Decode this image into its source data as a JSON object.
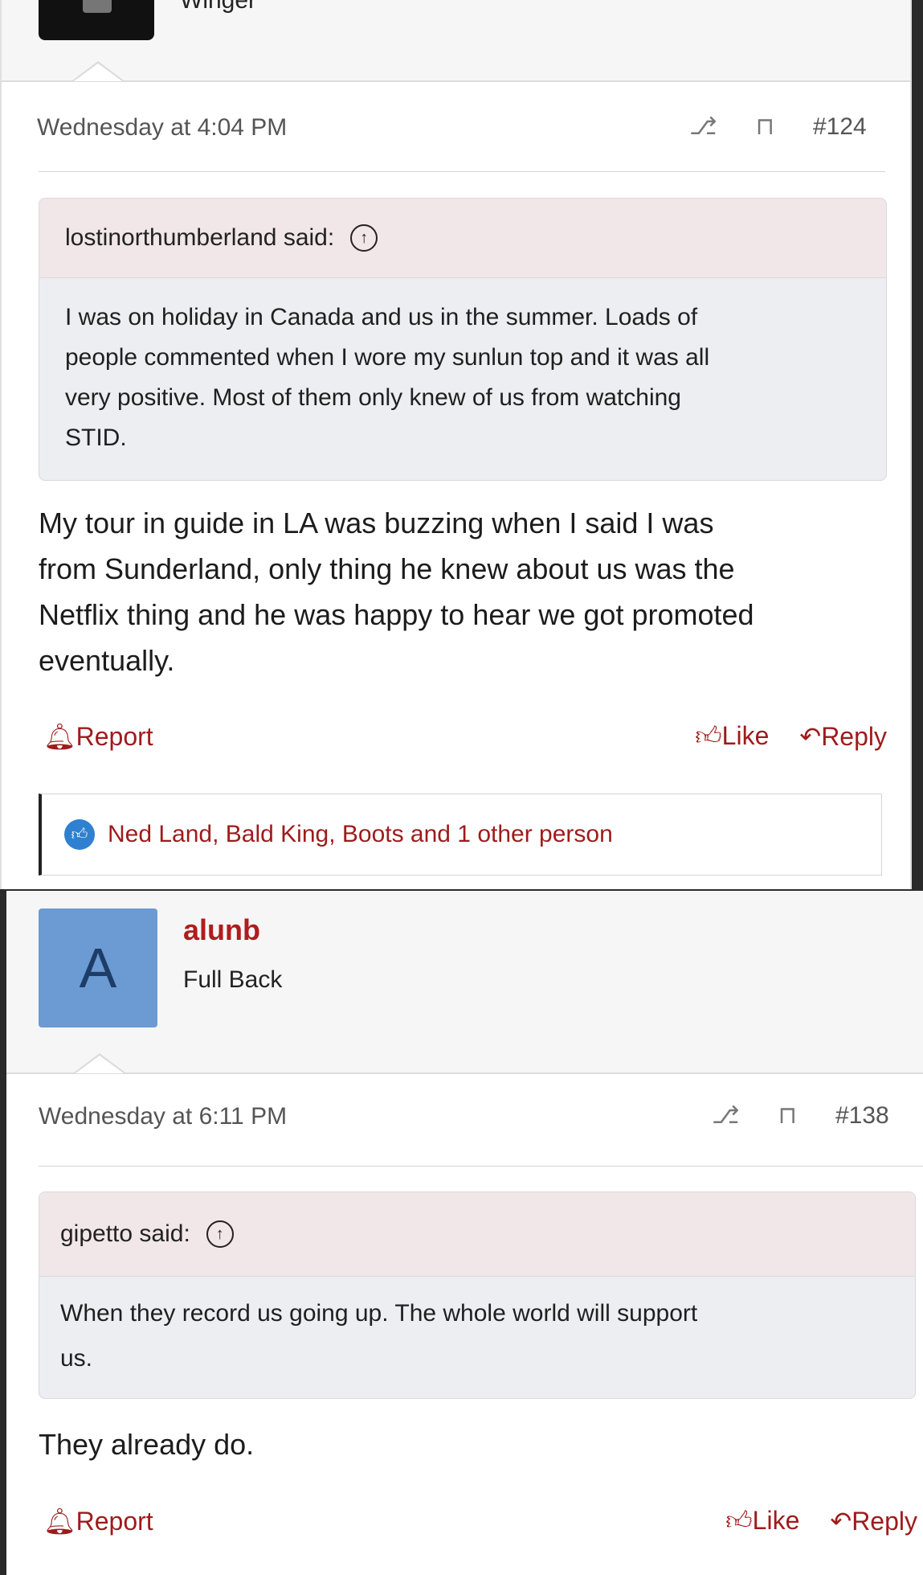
{
  "post1": {
    "user_title_fragment": "Winger",
    "date": "Wednesday at 4:04 PM",
    "share_icon": "share-icon",
    "bookmark_icon": "bookmark-icon",
    "number": "#124",
    "quote_author": "lostinorthumberland said:",
    "quote_lines": [
      "I was on holiday in Canada and us in the summer. Loads of",
      "people commented when I wore my sunlun top and it was all",
      "very positive. Most of them only knew of us from watching",
      "STID."
    ],
    "body_lines": [
      "My tour in guide in LA was buzzing when I said I was",
      "from Sunderland, only thing he knew about us was the",
      "Netflix thing and he was happy to hear we got promoted",
      "eventually."
    ],
    "report_label": "Report",
    "like_label": "Like",
    "reply_label": "Reply",
    "likes_text": "Ned Land, Bald King, Boots and 1 other person"
  },
  "post2": {
    "avatar_letter": "A",
    "username": "alunb",
    "user_title": "Full Back",
    "date": "Wednesday at 6:11 PM",
    "number": "#138",
    "quote_author": "gipetto said:",
    "quote_lines": [
      "When they record us going up. The whole world will support",
      "us."
    ],
    "body_lines": [
      "They already do."
    ],
    "report_label": "Report",
    "like_label": "Like",
    "reply_label": "Reply"
  },
  "colors": {
    "accent": "#9e1b1b",
    "username": "#b01c1c",
    "avatar_bg": "#6b9bd2",
    "quote_head_bg": "#f1e6e8",
    "quote_body_bg": "#eceef1",
    "like_badge": "#2f80d0"
  }
}
